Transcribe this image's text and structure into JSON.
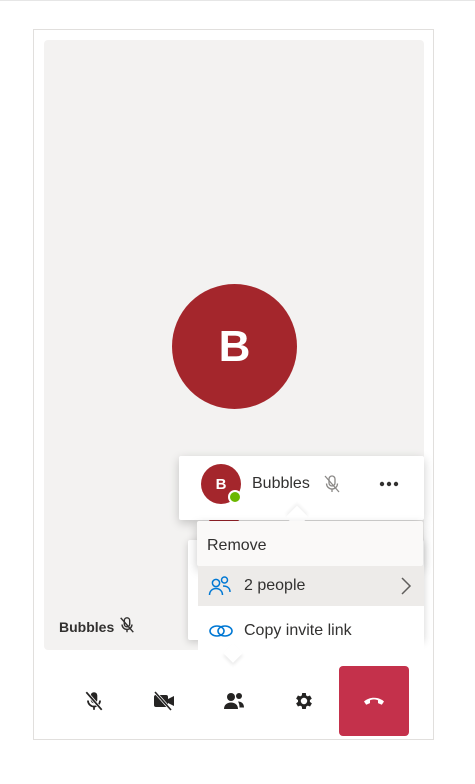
{
  "call": {
    "main_avatar_initial": "B",
    "tile_name": "Bubbles"
  },
  "participants_panel": {
    "participant": {
      "initial": "B",
      "name": "Bubbles",
      "presence": "available"
    }
  },
  "context_menu": {
    "remove_label": "Remove"
  },
  "people_row": {
    "label": "2 people"
  },
  "invite_row": {
    "label": "Copy invite link"
  },
  "controls": {
    "icons": [
      "mic-off-icon",
      "camera-off-icon",
      "people-icon",
      "settings-icon",
      "hang-up-icon"
    ]
  },
  "colors": {
    "avatar": "#a4262c",
    "presence": "#6bb700",
    "hangup": "#c4314b",
    "stage_bg": "#f3f2f1",
    "accent_blue": "#0078d4"
  }
}
